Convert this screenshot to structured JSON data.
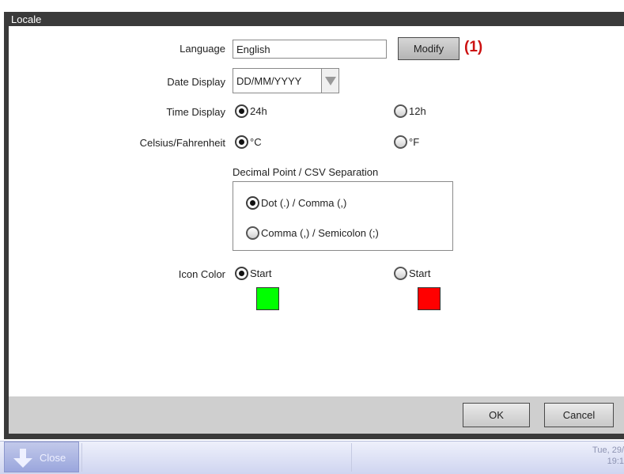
{
  "window": {
    "title": "Locale"
  },
  "language": {
    "label": "Language",
    "value": "English",
    "modify_label": "Modify",
    "annotation": "(1)"
  },
  "date_display": {
    "label": "Date Display",
    "value": "DD/MM/YYYY"
  },
  "time_display": {
    "label": "Time Display",
    "option_a": "24h",
    "option_b": "12h",
    "selected": "24h"
  },
  "temperature": {
    "label": "Celsius/Fahrenheit",
    "option_a": "°C",
    "option_b": "°F",
    "selected": "°C"
  },
  "decimal": {
    "label": "Decimal Point / CSV Separation",
    "option_a": "Dot (.) / Comma (,)",
    "option_b": "Comma (,) / Semicolon (;)",
    "selected": "Dot (.) / Comma (,)"
  },
  "icon_color": {
    "label": "Icon Color",
    "option_a": "Start",
    "option_b": "Start",
    "color_a": "#00ff00",
    "color_b": "#ff0000",
    "selected": "a"
  },
  "footer": {
    "ok_label": "OK",
    "cancel_label": "Cancel"
  },
  "taskbar": {
    "close_label": "Close",
    "date": "Tue, 29/",
    "time": "19:1"
  }
}
